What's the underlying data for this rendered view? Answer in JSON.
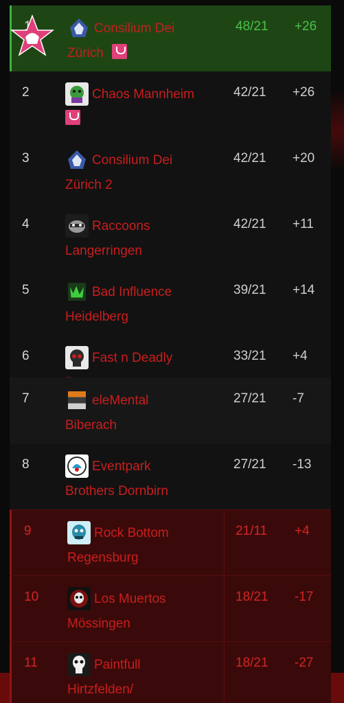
{
  "standings": {
    "rows": [
      {
        "rank": "1",
        "name_line1": "Consilium Dei",
        "name_line2": "Zürich",
        "score": "48/21",
        "diff": "+26",
        "logo_icon": "helmet-logo-icon"
      },
      {
        "rank": "2",
        "name_line1": "Chaos Mannheim",
        "name_line2": "",
        "score": "42/21",
        "diff": "+26",
        "logo_icon": "monster-logo-icon"
      },
      {
        "rank": "3",
        "name_line1": "Consilium Dei",
        "name_line2": "Zürich 2",
        "score": "42/21",
        "diff": "+20",
        "logo_icon": "helmet-logo-icon"
      },
      {
        "rank": "4",
        "name_line1": "Raccoons",
        "name_line2": "Langerringen",
        "score": "42/21",
        "diff": "+11",
        "logo_icon": "raccoon-logo-icon"
      },
      {
        "rank": "5",
        "name_line1": "Bad Influence",
        "name_line2": "Heidelberg",
        "score": "39/21",
        "diff": "+14",
        "logo_icon": "bad-influence-logo-icon"
      },
      {
        "rank": "6",
        "name_line1": "Fast n Deadly Bern",
        "name_line2": "",
        "score": "33/21",
        "diff": "+4",
        "logo_icon": "skull-logo-icon"
      },
      {
        "rank": "7",
        "name_line1": "eleMental",
        "name_line2": "Biberach",
        "score": "27/21",
        "diff": "-7",
        "logo_icon": "elemental-logo-icon"
      },
      {
        "rank": "8",
        "name_line1": "Eventpark",
        "name_line2": "Brothers Dornbirn",
        "score": "27/21",
        "diff": "-13",
        "logo_icon": "eventpark-logo-icon"
      },
      {
        "rank": "9",
        "name_line1": "Rock Bottom",
        "name_line2": "Regensburg",
        "score": "21/11",
        "diff": "+4",
        "logo_icon": "rock-bottom-logo-icon"
      },
      {
        "rank": "10",
        "name_line1": "Los Muertos",
        "name_line2": "Mössingen",
        "score": "18/21",
        "diff": "-17",
        "logo_icon": "los-muertos-logo-icon"
      },
      {
        "rank": "11",
        "name_line1": "Paintfull",
        "name_line2": "Hirtzfelden/",
        "score": "18/21",
        "diff": "-27",
        "logo_icon": "punisher-logo-icon"
      }
    ]
  },
  "colors": {
    "team_name": "#c91e1e",
    "leader_green": "#4bc14b",
    "relegation_red": "#d32424",
    "trophy_pink": "#e0407a"
  }
}
